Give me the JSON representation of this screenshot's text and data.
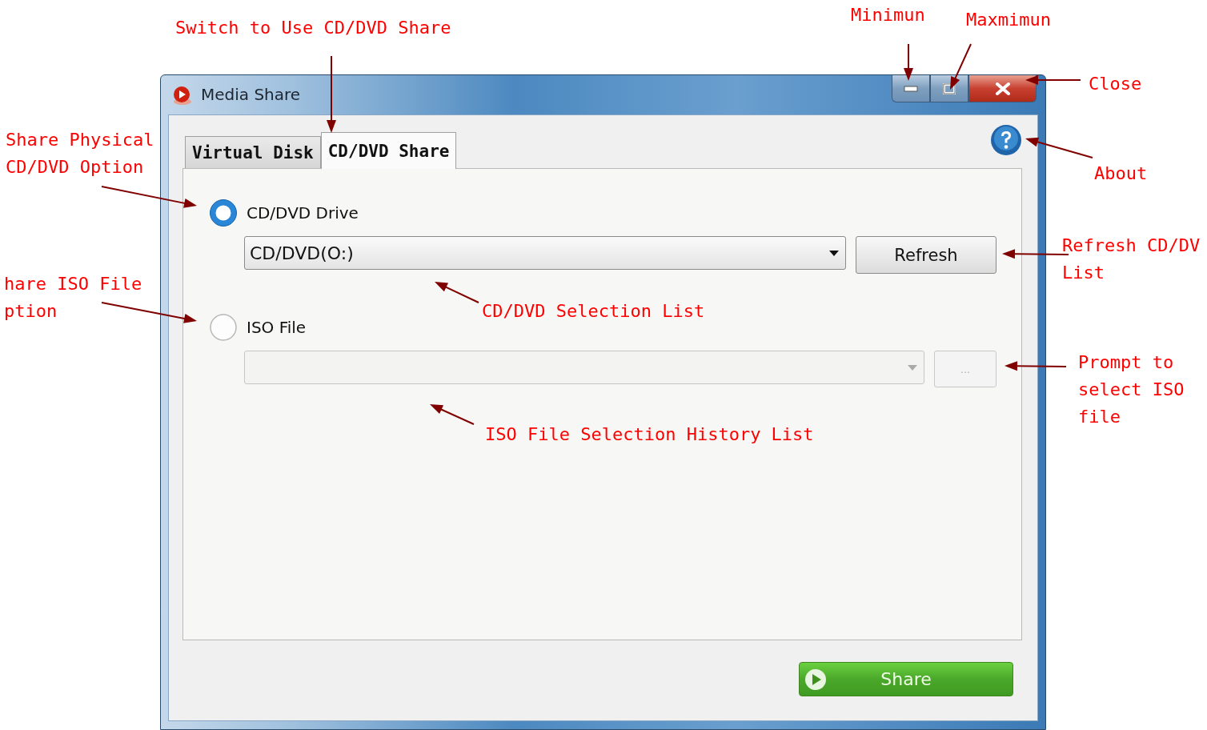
{
  "window": {
    "title": "Media Share"
  },
  "tabs": [
    {
      "label": "Virtual Disk",
      "selected": false
    },
    {
      "label": "CD/DVD Share",
      "selected": true
    }
  ],
  "options": [
    {
      "label": "CD/DVD Drive",
      "selected": true
    },
    {
      "label": "ISO File",
      "selected": false
    }
  ],
  "drive_dropdown": {
    "value": "CD/DVD(O:)",
    "disabled": false
  },
  "refresh_button": {
    "label": "Refresh",
    "disabled": false
  },
  "iso_dropdown": {
    "disabled": true
  },
  "browse_button": {
    "label": "...",
    "disabled": true
  },
  "share_button": {
    "label": "Share"
  },
  "annotations": [
    {
      "lines": [
        "Switch to Use CD/DVD Share"
      ]
    },
    {
      "lines": [
        "Minimun"
      ]
    },
    {
      "lines": [
        "Maxmimun"
      ]
    },
    {
      "lines": [
        "Close"
      ]
    },
    {
      "lines": [
        "About"
      ]
    },
    {
      "lines": [
        "Share Physical",
        "CD/DVD Option"
      ]
    },
    {
      "lines": [
        "hare ISO File",
        "ption"
      ]
    },
    {
      "lines": [
        "Refresh CD/DV",
        "List"
      ]
    },
    {
      "lines": [
        "CD/DVD Selection List"
      ]
    },
    {
      "lines": [
        "Prompt to",
        "select ISO",
        "file"
      ]
    },
    {
      "lines": [
        "ISO File Selection History List"
      ]
    }
  ]
}
